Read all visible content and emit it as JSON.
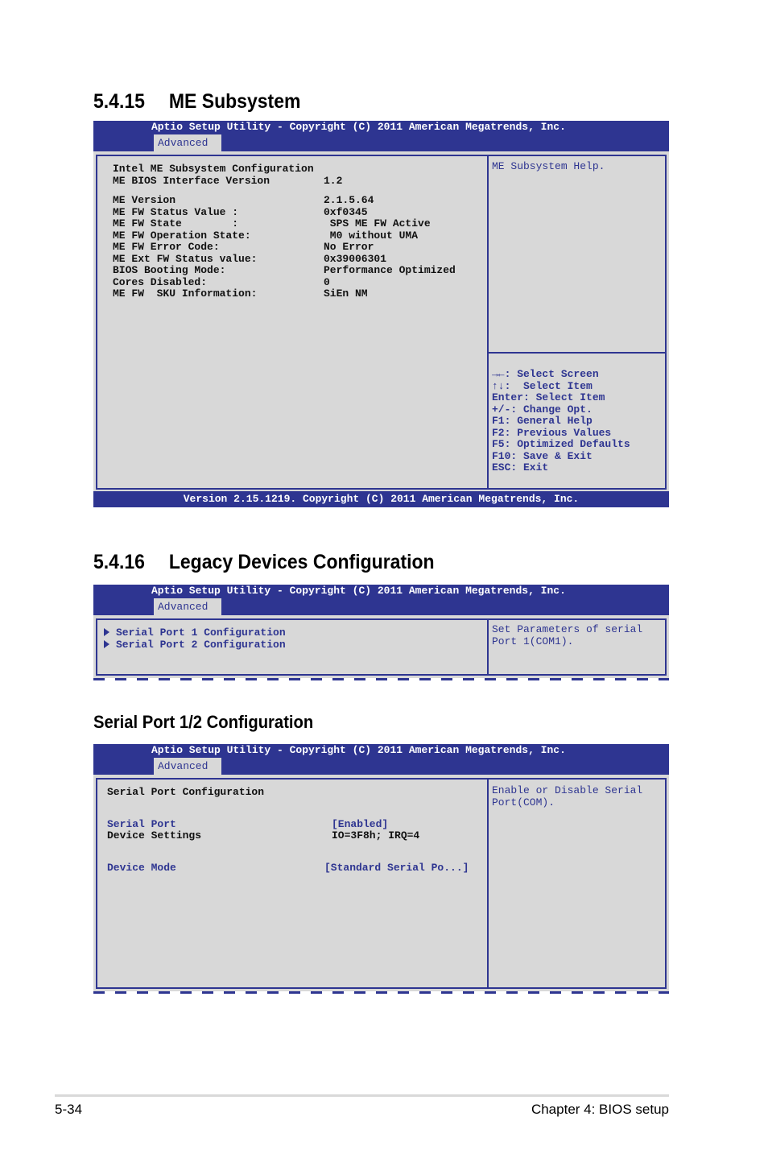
{
  "sections": {
    "me": {
      "number": "5.4.15",
      "title": "ME Subsystem"
    },
    "legacy": {
      "number": "5.4.16",
      "title": "Legacy Devices Configuration"
    },
    "serial": {
      "title": "Serial Port 1/2 Configuration"
    }
  },
  "bios_common": {
    "title": "Aptio Setup Utility - Copyright (C) 2011 American Megatrends, Inc.",
    "tab": "Advanced",
    "version_footer": "Version 2.15.1219. Copyright (C) 2011 American Megatrends, Inc."
  },
  "me_screen": {
    "heading": "Intel ME Subsystem Configuration",
    "rows": [
      {
        "label": "ME BIOS Interface Version",
        "value": "1.2"
      },
      {
        "label": "ME Version",
        "value": "2.1.5.64"
      },
      {
        "label": "ME FW Status Value :",
        "value": "0xf0345"
      },
      {
        "label": "ME FW State        :",
        "value": " SPS ME FW Active"
      },
      {
        "label": "ME FW Operation State:",
        "value": " M0 without UMA"
      },
      {
        "label": "ME FW Error Code:",
        "value": "No Error"
      },
      {
        "label": "ME Ext FW Status value:",
        "value": "0x39006301"
      },
      {
        "label": "BIOS Booting Mode:",
        "value": "Performance Optimized"
      },
      {
        "label": "Cores Disabled:",
        "value": "0"
      },
      {
        "label": "ME FW  SKU Information:",
        "value": "SiEn NM"
      }
    ],
    "help": "ME Subsystem Help.",
    "keys": [
      "→←: Select Screen",
      "↑↓:  Select Item",
      "Enter: Select Item",
      "+/-: Change Opt.",
      "F1: General Help",
      "F2: Previous Values",
      "F5: Optimized Defaults",
      "F10: Save & Exit",
      "ESC: Exit"
    ]
  },
  "legacy_screen": {
    "items": [
      "Serial Port 1 Configuration",
      "Serial Port 2 Configuration"
    ],
    "help": [
      "Set Parameters of serial",
      "Port 1(COM1)."
    ]
  },
  "serial_screen": {
    "heading": "Serial Port Configuration",
    "serial_port": {
      "label": "Serial Port",
      "value": "[Enabled]"
    },
    "device_settings": {
      "label": "Device Settings",
      "value": "IO=3F8h; IRQ=4"
    },
    "device_mode": {
      "label": "Device Mode",
      "value": "[Standard Serial Po...]"
    },
    "help": [
      "Enable or Disable Serial",
      "Port(COM)."
    ]
  },
  "page_footer": {
    "page_number": "5-34",
    "chapter": "Chapter 4: BIOS setup"
  }
}
